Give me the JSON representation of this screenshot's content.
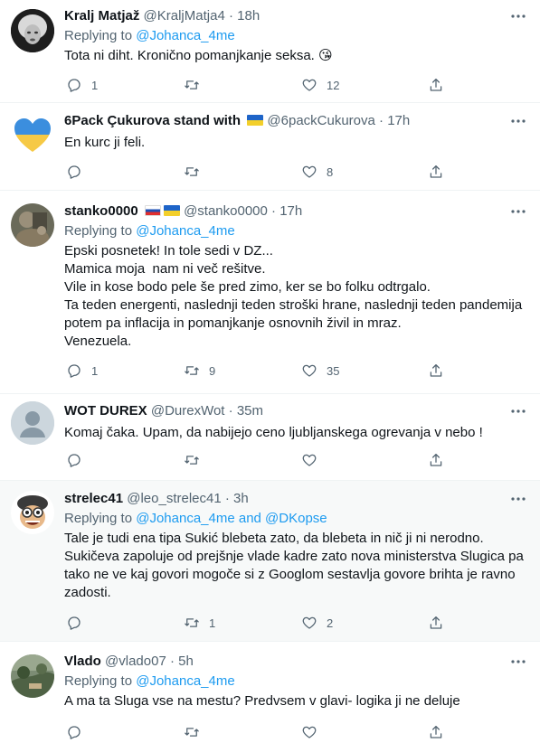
{
  "colors": {
    "link": "#1d9bf0",
    "muted": "#536471",
    "text": "#0f1419",
    "highlight_bg": "#f7f9f9"
  },
  "tweets": [
    {
      "name": "Kralj Matjaž",
      "handle": "@KraljMatja4",
      "time": "18h",
      "replying_prefix": "Replying to ",
      "replying_to": "@Johanca_4me",
      "text": "Tota ni diht. Kronično pomanjkanje seksa. 😘",
      "replies": "1",
      "retweets": "",
      "likes": "12",
      "avatar_icon": "marilyn-avatar"
    },
    {
      "name": "6Pack Çukurova stand with",
      "handle": "@6packCukurova",
      "time": "17h",
      "text": "En kurc ji feli.",
      "replies": "",
      "retweets": "",
      "likes": "8",
      "avatar_icon": "ukraine-heart-avatar"
    },
    {
      "name": "stanko0000",
      "handle": "@stanko0000",
      "time": "17h",
      "replying_prefix": "Replying to ",
      "replying_to": "@Johanca_4me",
      "text": "Epski posnetek! In tole sedi v DZ...\nMamica moja  nam ni več rešitve.\nVile in kose bodo pele še pred zimo, ker se bo folku odtrgalo.\nTa teden energenti, naslednji teden stroški hrane, naslednji teden pandemija potem pa inflacija in pomanjkanje osnovnih živil in mraz.\nVenezuela.",
      "replies": "1",
      "retweets": "9",
      "likes": "35",
      "avatar_icon": "photo-avatar"
    },
    {
      "name": "WOT DUREX",
      "handle": "@DurexWot",
      "time": "35m",
      "text": "Komaj čaka. Upam, da nabijejo ceno ljubljanskega ogrevanja v nebo !",
      "replies": "",
      "retweets": "",
      "likes": "",
      "avatar_icon": "default-avatar"
    },
    {
      "name": "strelec41",
      "handle": "@leo_strelec41",
      "time": "3h",
      "replying_prefix": "Replying to ",
      "replying_to": "@Johanca_4me and @DKopse",
      "text": "Tale je tudi ena tipa Sukić blebeta zato, da blebeta in nič ji ni nerodno. Sukičeva zapoluje od prejšnje vlade kadre zato nova ministerstva Slugica pa tako ne ve kaj govori mogoče si z Googlom sestavlja govore brihta je ravno zadosti.",
      "replies": "",
      "retweets": "1",
      "likes": "2",
      "avatar_icon": "cartoon-pilot-avatar"
    },
    {
      "name": "Vlado",
      "handle": "@vlado07",
      "time": "5h",
      "replying_prefix": "Replying to ",
      "replying_to": "@Johanca_4me",
      "text": "A ma ta Sluga vse na mestu? Predvsem v glavi- logika ji ne deluje",
      "replies": "",
      "retweets": "",
      "likes": "",
      "avatar_icon": "landscape-avatar"
    }
  ]
}
